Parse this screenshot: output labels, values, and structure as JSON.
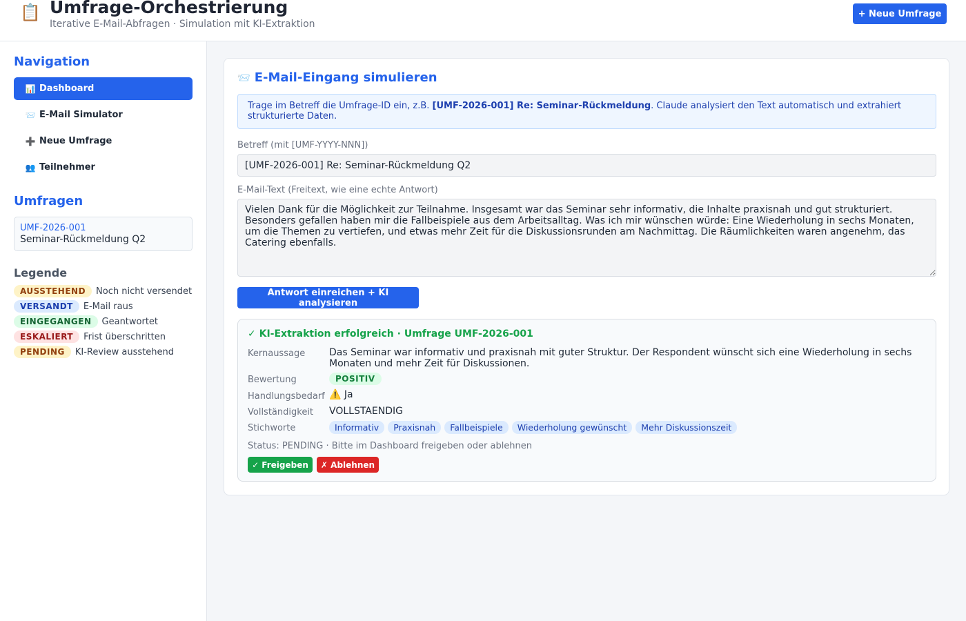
{
  "header": {
    "icon": "clipboard-icon",
    "title": "Umfrage-Orchestrierung",
    "subtitle": "Iterative E-Mail-Abfragen · Simulation mit KI-Extraktion",
    "new_survey_button": "+ Neue Umfrage"
  },
  "sidebar": {
    "nav_heading": "Navigation",
    "nav_items": [
      {
        "icon": "📊",
        "label": "Dashboard",
        "active": true
      },
      {
        "icon": "📨",
        "label": "E-Mail Simulator",
        "active": false
      },
      {
        "icon": "➕",
        "label": "Neue Umfrage",
        "active": false
      },
      {
        "icon": "👥",
        "label": "Teilnehmer",
        "active": false
      }
    ],
    "surveys_heading": "Umfragen",
    "surveys": [
      {
        "id": "UMF-2026-001",
        "name": "Seminar-Rückmeldung Q2"
      }
    ],
    "legend_heading": "Legende",
    "legend": [
      {
        "badge": "AUSSTEHEND",
        "text": "Noch nicht versendet",
        "bg": "#fef3c7",
        "fg": "#92400e"
      },
      {
        "badge": "VERSANDT",
        "text": "E-Mail raus",
        "bg": "#dbeafe",
        "fg": "#1e40af"
      },
      {
        "badge": "EINGEGANGEN",
        "text": "Geantwortet",
        "bg": "#dcfce7",
        "fg": "#166534"
      },
      {
        "badge": "ESKALIERT",
        "text": "Frist überschritten",
        "bg": "#fee2e2",
        "fg": "#991b1b"
      },
      {
        "badge": "PENDING",
        "text": "KI-Review ausstehend",
        "bg": "#fef3c7",
        "fg": "#92400e"
      }
    ]
  },
  "simulator": {
    "icon": "📨",
    "title": "E-Mail-Eingang simulieren",
    "info_prefix": "Trage im Betreff die Umfrage-ID ein, z.B. ",
    "info_example": "[UMF-2026-001] Re: Seminar-Rückmeldung",
    "info_suffix": ". Claude analysiert den Text automatisch und extrahiert strukturierte Daten.",
    "subject_label": "Betreff (mit [UMF-YYYY-NNN])",
    "subject_value": "[UMF-2026-001] Re: Seminar-Rückmeldung Q2",
    "body_label": "E-Mail-Text (Freitext, wie eine echte Antwort)",
    "body_value": "Vielen Dank für die Möglichkeit zur Teilnahme. Insgesamt war das Seminar sehr informativ, die Inhalte praxisnah und gut strukturiert. Besonders gefallen haben mir die Fallbeispiele aus dem Arbeitsalltag. Was ich mir wünschen würde: Eine Wiederholung in sechs Monaten, um die Themen zu vertiefen, und etwas mehr Zeit für die Diskussionsrunden am Nachmittag. Die Räumlichkeiten waren angenehm, das Catering ebenfalls.",
    "submit_button": "Antwort einreichen + KI analysieren"
  },
  "result": {
    "title": "✓ KI-Extraktion erfolgreich · Umfrage UMF-2026-001",
    "kernaussage_label": "Kernaussage",
    "kernaussage": "Das Seminar war informativ und praxisnah mit guter Struktur. Der Respondent wünscht sich eine Wiederholung in sechs Monaten und mehr Zeit für Diskussionen.",
    "bewertung_label": "Bewertung",
    "bewertung": "POSITIV",
    "handlungsbedarf_label": "Handlungsbedarf",
    "handlungsbedarf_icon": "⚠️",
    "handlungsbedarf": "Ja",
    "vollstaendigkeit_label": "Vollständigkeit",
    "vollstaendigkeit": "VOLLSTAENDIG",
    "stichworte_label": "Stichworte",
    "stichworte": [
      "Informativ",
      "Praxisnah",
      "Fallbeispiele",
      "Wiederholung gewünscht",
      "Mehr Diskussionszeit"
    ],
    "status_line": "Status: PENDING · Bitte im Dashboard freigeben oder ablehnen",
    "approve_button": "✓ Freigeben",
    "reject_button": "✗ Ablehnen"
  }
}
